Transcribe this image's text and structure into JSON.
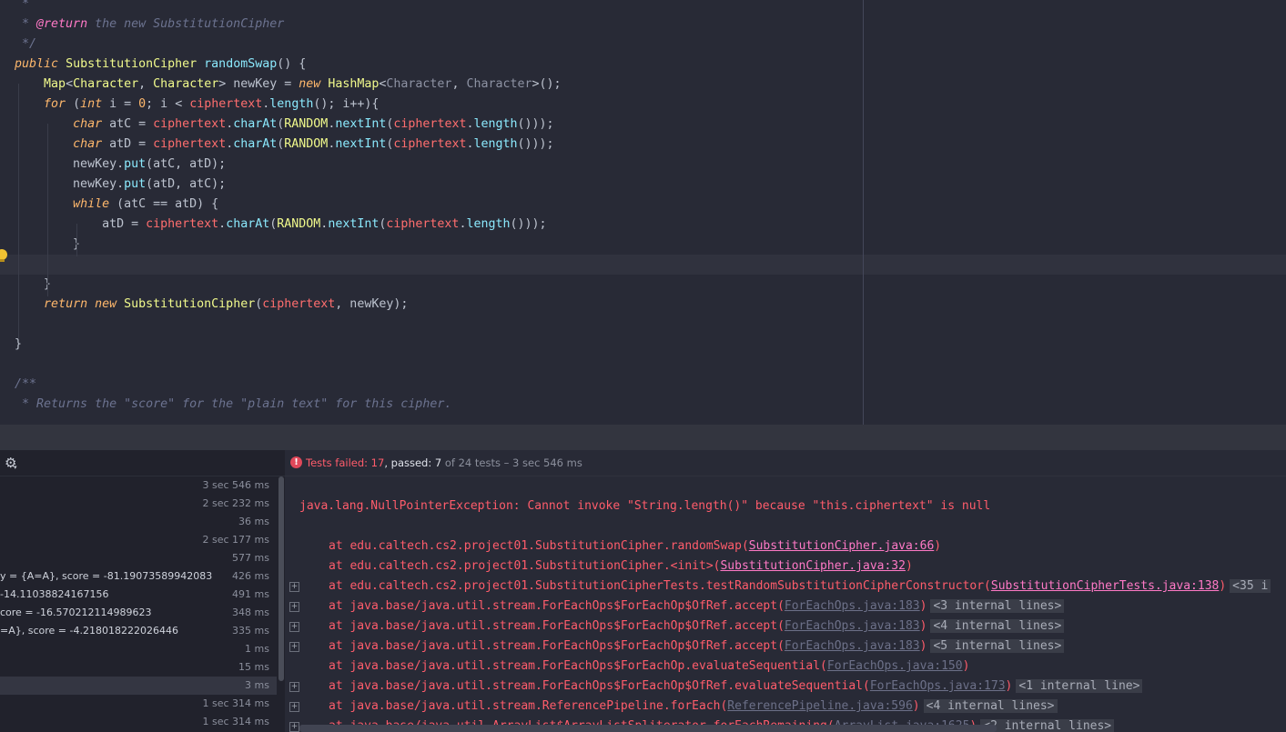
{
  "editor": {
    "lines": [
      [
        [
          "comment",
          "   *"
        ]
      ],
      [
        [
          "comment",
          "   * "
        ],
        [
          "annotation",
          "@return"
        ],
        [
          "comment",
          " the new SubstitutionCipher"
        ]
      ],
      [
        [
          "comment",
          "   */"
        ]
      ],
      [
        [
          "keyword",
          "  public "
        ],
        [
          "type",
          "SubstitutionCipher "
        ],
        [
          "method",
          "randomSwap"
        ],
        [
          "plain",
          "() {"
        ]
      ],
      [
        [
          "plain",
          "      "
        ],
        [
          "type",
          "Map"
        ],
        [
          "plain",
          "<"
        ],
        [
          "type",
          "Character"
        ],
        [
          "plain",
          ", "
        ],
        [
          "type",
          "Character"
        ],
        [
          "plain",
          "> newKey = "
        ],
        [
          "keyword",
          "new "
        ],
        [
          "type",
          "HashMap"
        ],
        [
          "plain",
          "<"
        ],
        [
          "dim",
          "Character"
        ],
        [
          "plain",
          ", "
        ],
        [
          "dim",
          "Character"
        ],
        [
          "plain",
          ">();"
        ]
      ],
      [
        [
          "plain",
          "      "
        ],
        [
          "keyword",
          "for "
        ],
        [
          "plain",
          "("
        ],
        [
          "keyword",
          "int "
        ],
        [
          "plain",
          "i = "
        ],
        [
          "number",
          "0"
        ],
        [
          "plain",
          "; i < "
        ],
        [
          "field",
          "ciphertext"
        ],
        [
          "plain",
          "."
        ],
        [
          "call",
          "length"
        ],
        [
          "plain",
          "(); i++){"
        ]
      ],
      [
        [
          "plain",
          "          "
        ],
        [
          "keyword",
          "char "
        ],
        [
          "plain",
          "atC = "
        ],
        [
          "field",
          "ciphertext"
        ],
        [
          "plain",
          "."
        ],
        [
          "call",
          "charAt"
        ],
        [
          "plain",
          "("
        ],
        [
          "type",
          "RANDOM"
        ],
        [
          "plain",
          "."
        ],
        [
          "call",
          "nextInt"
        ],
        [
          "plain",
          "("
        ],
        [
          "field",
          "ciphertext"
        ],
        [
          "plain",
          "."
        ],
        [
          "call",
          "length"
        ],
        [
          "plain",
          "()));"
        ]
      ],
      [
        [
          "plain",
          "          "
        ],
        [
          "keyword",
          "char "
        ],
        [
          "plain",
          "atD = "
        ],
        [
          "field",
          "ciphertext"
        ],
        [
          "plain",
          "."
        ],
        [
          "call",
          "charAt"
        ],
        [
          "plain",
          "("
        ],
        [
          "type",
          "RANDOM"
        ],
        [
          "plain",
          "."
        ],
        [
          "call",
          "nextInt"
        ],
        [
          "plain",
          "("
        ],
        [
          "field",
          "ciphertext"
        ],
        [
          "plain",
          "."
        ],
        [
          "call",
          "length"
        ],
        [
          "plain",
          "()));"
        ]
      ],
      [
        [
          "plain",
          "          newKey."
        ],
        [
          "call",
          "put"
        ],
        [
          "plain",
          "(atC, atD);"
        ]
      ],
      [
        [
          "plain",
          "          newKey."
        ],
        [
          "call",
          "put"
        ],
        [
          "plain",
          "(atD, atC);"
        ]
      ],
      [
        [
          "plain",
          "          "
        ],
        [
          "keyword",
          "while "
        ],
        [
          "plain",
          "(atC == atD) {"
        ]
      ],
      [
        [
          "plain",
          "              atD = "
        ],
        [
          "field",
          "ciphertext"
        ],
        [
          "plain",
          "."
        ],
        [
          "call",
          "charAt"
        ],
        [
          "plain",
          "("
        ],
        [
          "type",
          "RANDOM"
        ],
        [
          "plain",
          "."
        ],
        [
          "call",
          "nextInt"
        ],
        [
          "plain",
          "("
        ],
        [
          "field",
          "ciphertext"
        ],
        [
          "plain",
          "."
        ],
        [
          "call",
          "length"
        ],
        [
          "plain",
          "()));"
        ]
      ],
      [
        [
          "plain",
          "          }"
        ]
      ],
      [
        [
          "plain",
          ""
        ]
      ],
      [
        [
          "plain",
          "      }"
        ]
      ],
      [
        [
          "plain",
          "      "
        ],
        [
          "keyword",
          "return new "
        ],
        [
          "type",
          "SubstitutionCipher"
        ],
        [
          "plain",
          "("
        ],
        [
          "field",
          "ciphertext"
        ],
        [
          "plain",
          ", newKey);"
        ]
      ],
      [
        [
          "plain",
          ""
        ]
      ],
      [
        [
          "plain",
          "  }"
        ]
      ],
      [
        [
          "plain",
          ""
        ]
      ],
      [
        [
          "comment",
          "  /**"
        ]
      ],
      [
        [
          "comment",
          "   * Returns the \"score\" for the \"plain text\" for this cipher."
        ]
      ]
    ]
  },
  "tests": {
    "rows": [
      {
        "name": "",
        "duration": "3 sec 546 ms"
      },
      {
        "name": "",
        "duration": "2 sec 232 ms"
      },
      {
        "name": "",
        "duration": "36 ms"
      },
      {
        "name": "",
        "duration": "2 sec 177 ms"
      },
      {
        "name": "",
        "duration": "577 ms"
      },
      {
        "name": "y = {A=A}, score = -81.19073589942083",
        "duration": "426 ms"
      },
      {
        "name": " -14.11038824167156",
        "duration": "491 ms"
      },
      {
        "name": "core = -16.570212114989623",
        "duration": "348 ms"
      },
      {
        "name": "=A}, score = -4.218018222026446",
        "duration": "335 ms"
      },
      {
        "name": "",
        "duration": "1 ms"
      },
      {
        "name": "",
        "duration": "15 ms"
      },
      {
        "name": "",
        "duration": "3 ms"
      },
      {
        "name": "",
        "duration": "1 sec 314 ms"
      },
      {
        "name": "",
        "duration": "1 sec 314 ms"
      }
    ]
  },
  "status": {
    "failed_label": "Tests failed: 17",
    "passed_label": ", passed: 7",
    "total_label": " of 24 tests – 3 sec 546 ms"
  },
  "console": {
    "exception": "java.lang.NullPointerException: Cannot invoke \"String.length()\" because \"this.ciphertext\" is null",
    "trace": [
      {
        "text": "at edu.caltech.cs2.project01.SubstitutionCipher.randomSwap(",
        "link": "SubstitutionCipher.java:66",
        "suffix": ")",
        "internal": "",
        "expandable": false,
        "lib": false
      },
      {
        "text": "at edu.caltech.cs2.project01.SubstitutionCipher.<init>(",
        "link": "SubstitutionCipher.java:32",
        "suffix": ")",
        "internal": "",
        "expandable": false,
        "lib": false
      },
      {
        "text": "at edu.caltech.cs2.project01.SubstitutionCipherTests.testRandomSubstitutionCipherConstructor(",
        "link": "SubstitutionCipherTests.java:138",
        "suffix": ")",
        "internal": "<35 i",
        "expandable": true,
        "lib": false
      },
      {
        "text": "at java.base/java.util.stream.ForEachOps$ForEachOp$OfRef.accept(",
        "link": "ForEachOps.java:183",
        "suffix": ")",
        "internal": "<3 internal lines>",
        "expandable": true,
        "lib": true
      },
      {
        "text": "at java.base/java.util.stream.ForEachOps$ForEachOp$OfRef.accept(",
        "link": "ForEachOps.java:183",
        "suffix": ")",
        "internal": "<4 internal lines>",
        "expandable": true,
        "lib": true
      },
      {
        "text": "at java.base/java.util.stream.ForEachOps$ForEachOp$OfRef.accept(",
        "link": "ForEachOps.java:183",
        "suffix": ")",
        "internal": "<5 internal lines>",
        "expandable": true,
        "lib": true
      },
      {
        "text": "at java.base/java.util.stream.ForEachOps$ForEachOp.evaluateSequential(",
        "link": "ForEachOps.java:150",
        "suffix": ")",
        "internal": "",
        "expandable": false,
        "lib": true
      },
      {
        "text": "at java.base/java.util.stream.ForEachOps$ForEachOp$OfRef.evaluateSequential(",
        "link": "ForEachOps.java:173",
        "suffix": ")",
        "internal": "<1 internal line>",
        "expandable": true,
        "lib": true
      },
      {
        "text": "at java.base/java.util.stream.ReferencePipeline.forEach(",
        "link": "ReferencePipeline.java:596",
        "suffix": ")",
        "internal": "<4 internal lines>",
        "expandable": true,
        "lib": true
      },
      {
        "text": "at java.base/java.util.ArrayList$ArrayListSpliterator.forEachRemaining(",
        "link": "ArrayList.java:1625",
        "suffix": ")",
        "internal": "<2 internal lines>",
        "expandable": true,
        "lib": true
      }
    ]
  },
  "colors": {
    "comment": "#6c7390",
    "annotation": "#ff79c6",
    "keyword": "#ffb86c",
    "type": "#f1fa8c",
    "method": "#8be9fd",
    "call": "#8be9fd",
    "field": "#ff6e6e",
    "number": "#ffb86c",
    "plain": "#bdc3cf",
    "dim": "#8d92a3"
  }
}
